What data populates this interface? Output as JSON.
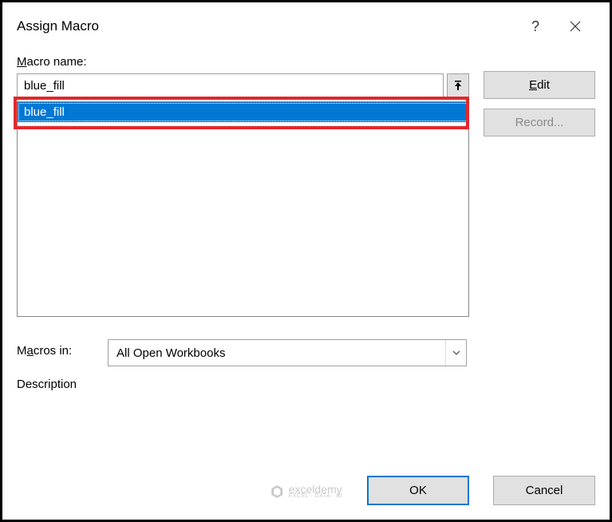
{
  "dialog": {
    "title": "Assign Macro",
    "help_symbol": "?",
    "macro_name_label_pre": "M",
    "macro_name_label_post": "acro name:",
    "macro_name_value": "blue_fill",
    "macros_in_label_pre": "M",
    "macros_in_label_post": "acros in:",
    "macros_in_selected": "All Open Workbooks",
    "description_label": "Description"
  },
  "list": {
    "items": [
      "blue_fill"
    ]
  },
  "buttons": {
    "edit_pre": "E",
    "edit_post": "dit",
    "record": "Record...",
    "ok": "OK",
    "cancel": "Cancel"
  },
  "watermark": {
    "brand": "exceldemy",
    "tagline": "EXCEL · DATA · BI"
  }
}
